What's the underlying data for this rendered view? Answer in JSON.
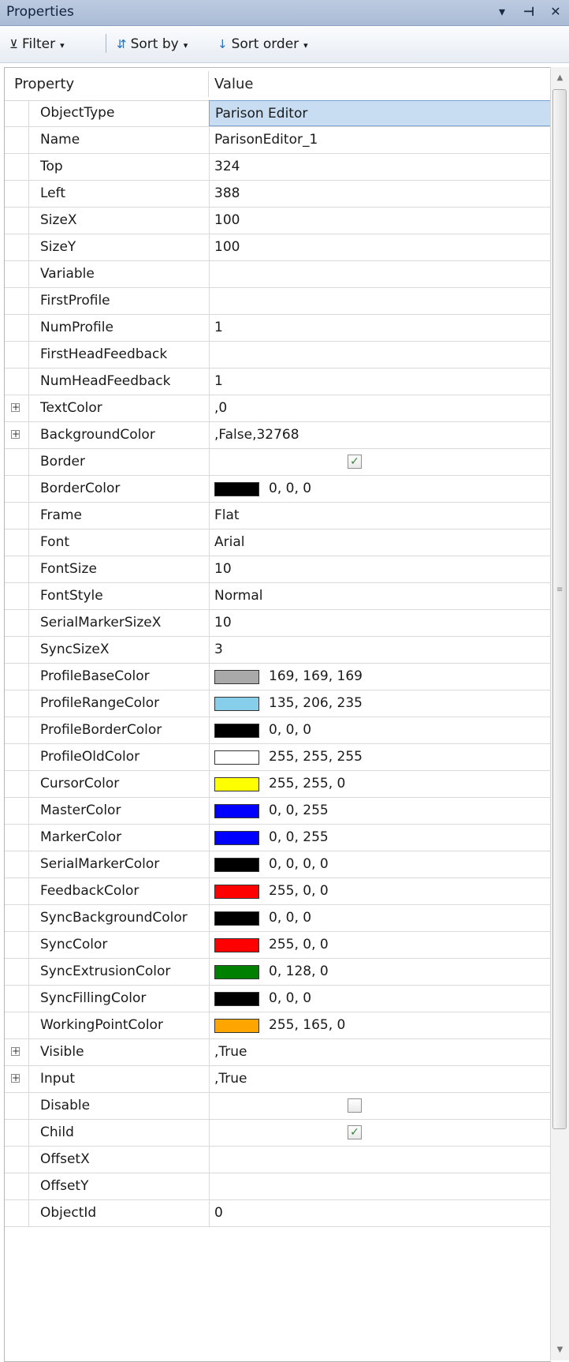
{
  "panel": {
    "title": "Properties"
  },
  "titlebar_buttons": {
    "dropdown": "▾",
    "pin": "⊣",
    "close": "✕"
  },
  "toolbar": {
    "filter_label": "Filter",
    "sortby_label": "Sort by",
    "sortorder_label": "Sort order",
    "arrow": "▾"
  },
  "grid": {
    "header_property": "Property",
    "header_value": "Value",
    "rows": [
      {
        "name": "ObjectType",
        "value": "Parison Editor",
        "selected": true
      },
      {
        "name": "Name",
        "value": "ParisonEditor_1"
      },
      {
        "name": "Top",
        "value": "324"
      },
      {
        "name": "Left",
        "value": "388"
      },
      {
        "name": "SizeX",
        "value": "100"
      },
      {
        "name": "SizeY",
        "value": "100"
      },
      {
        "name": "Variable",
        "value": ""
      },
      {
        "name": "FirstProfile",
        "value": ""
      },
      {
        "name": "NumProfile",
        "value": "1"
      },
      {
        "name": "FirstHeadFeedback",
        "value": ""
      },
      {
        "name": "NumHeadFeedback",
        "value": "1"
      },
      {
        "name": "TextColor",
        "value": ",0",
        "expandable": true
      },
      {
        "name": "BackgroundColor",
        "value": ",False,32768",
        "expandable": true
      },
      {
        "name": "Border",
        "checkbox": true,
        "checked": true
      },
      {
        "name": "BorderColor",
        "value": "0, 0, 0",
        "color": "#000000"
      },
      {
        "name": "Frame",
        "value": "Flat"
      },
      {
        "name": "Font",
        "value": "Arial"
      },
      {
        "name": "FontSize",
        "value": "10"
      },
      {
        "name": "FontStyle",
        "value": "Normal"
      },
      {
        "name": "SerialMarkerSizeX",
        "value": "10"
      },
      {
        "name": "SyncSizeX",
        "value": "3"
      },
      {
        "name": "ProfileBaseColor",
        "value": "169, 169, 169",
        "color": "#a9a9a9"
      },
      {
        "name": "ProfileRangeColor",
        "value": "135, 206, 235",
        "color": "#87ceeb"
      },
      {
        "name": "ProfileBorderColor",
        "value": "0, 0, 0",
        "color": "#000000"
      },
      {
        "name": "ProfileOldColor",
        "value": "255, 255, 255",
        "color": "#ffffff"
      },
      {
        "name": "CursorColor",
        "value": "255, 255, 0",
        "color": "#ffff00"
      },
      {
        "name": "MasterColor",
        "value": "0, 0, 255",
        "color": "#0000ff"
      },
      {
        "name": "MarkerColor",
        "value": "0, 0, 255",
        "color": "#0000ff"
      },
      {
        "name": "SerialMarkerColor",
        "value": "0, 0, 0, 0",
        "color": "#000000"
      },
      {
        "name": "FeedbackColor",
        "value": "255, 0, 0",
        "color": "#ff0000"
      },
      {
        "name": "SyncBackgroundColor",
        "value": "0, 0, 0",
        "color": "#000000"
      },
      {
        "name": "SyncColor",
        "value": "255, 0, 0",
        "color": "#ff0000"
      },
      {
        "name": "SyncExtrusionColor",
        "value": "0, 128, 0",
        "color": "#008000"
      },
      {
        "name": "SyncFillingColor",
        "value": "0, 0, 0",
        "color": "#000000"
      },
      {
        "name": "WorkingPointColor",
        "value": "255, 165, 0",
        "color": "#ffa500"
      },
      {
        "name": "Visible",
        "value": ",True",
        "expandable": true
      },
      {
        "name": "Input",
        "value": ",True",
        "expandable": true
      },
      {
        "name": "Disable",
        "checkbox": true,
        "checked": false
      },
      {
        "name": "Child",
        "checkbox": true,
        "checked": true
      },
      {
        "name": "OffsetX",
        "value": ""
      },
      {
        "name": "OffsetY",
        "value": ""
      },
      {
        "name": "ObjectId",
        "value": "0"
      }
    ]
  }
}
